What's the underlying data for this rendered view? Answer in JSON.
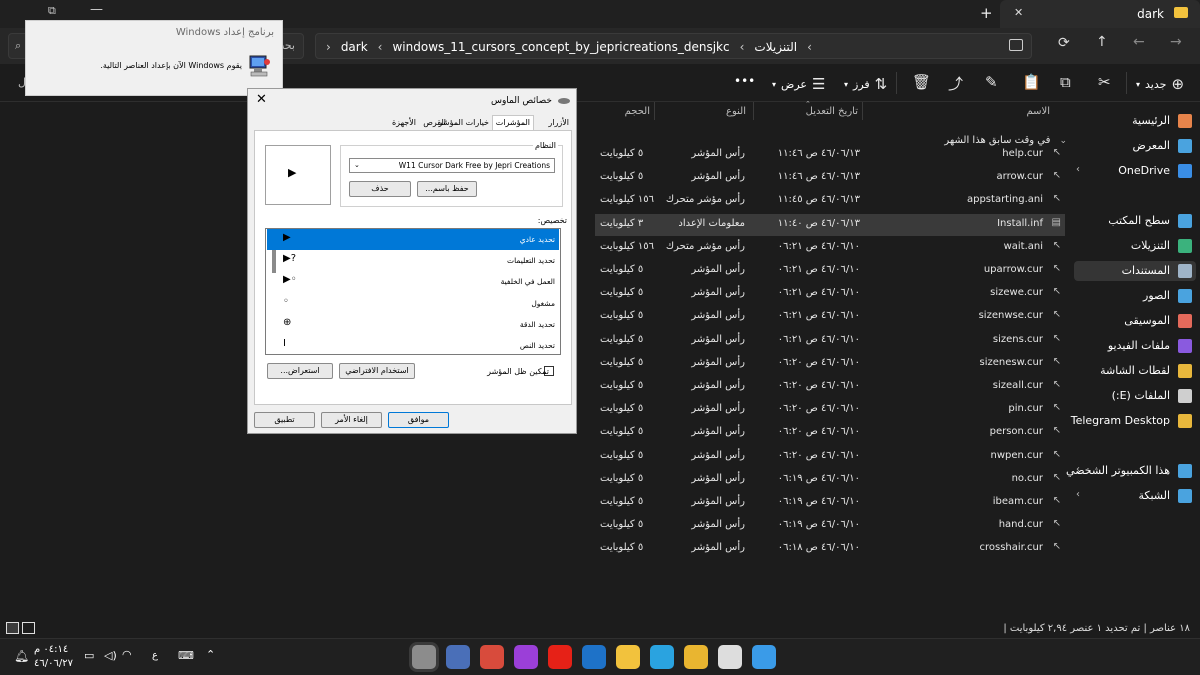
{
  "explorer": {
    "tab_title": "dark",
    "new_tab": "+",
    "tab_close": "✕",
    "window_controls": [
      "✕",
      "—"
    ],
    "breadcrumb": [
      "dark",
      "windows_11_cursors_concept_by_jepricreations_densjkc",
      "التنزيلات"
    ],
    "search_placeholder": "بحث",
    "toolbar": {
      "new_label": "جديد",
      "sort_label": "فرز",
      "view_label": "عرض",
      "more_label": "•••"
    },
    "sidebar": [
      {
        "label": "الرئيسية",
        "color": "#e7844b"
      },
      {
        "label": "المعرض",
        "color": "#4aa3df"
      },
      {
        "label": "OneDrive",
        "color": "#3a8ee6",
        "chev": true
      },
      {
        "label": "سطح المكتب",
        "color": "#4aa3df"
      },
      {
        "label": "التنزيلات",
        "color": "#3bb27d"
      },
      {
        "label": "المستندات",
        "color": "#9fb4c8",
        "selected": true
      },
      {
        "label": "الصور",
        "color": "#4aa3df"
      },
      {
        "label": "الموسيقى",
        "color": "#e46a5b"
      },
      {
        "label": "ملفات الفيديو",
        "color": "#8a5adf"
      },
      {
        "label": "لقطات الشاشة",
        "color": "#e8b73c"
      },
      {
        "label": "الملفات (E:)",
        "color": "#cfcfcf"
      },
      {
        "label": "Telegram Desktop",
        "color": "#e8b73c"
      },
      {
        "label": "هذا الكمبيوتر الشخصي",
        "color": "#4aa3df",
        "chev": true
      },
      {
        "label": "الشبكة",
        "color": "#4aa3df",
        "chev": true
      }
    ],
    "columns": {
      "name": "الاسم",
      "modified": "تاريخ التعديل",
      "type": "النوع",
      "size": "الحجم"
    },
    "group_header": "في وقت سابق هذا الشهر",
    "files": [
      {
        "name": "help.cur",
        "date": "٤٦/٠٦/١٣ ص ١١:٤٦",
        "type": "رأس المؤشر",
        "size": "٥ كيلوبايت"
      },
      {
        "name": "arrow.cur",
        "date": "٤٦/٠٦/١٣ ص ١١:٤٦",
        "type": "رأس المؤشر",
        "size": "٥ كيلوبايت"
      },
      {
        "name": "appstarting.ani",
        "date": "٤٦/٠٦/١٣ ص ١١:٤٥",
        "type": "رأس مؤشر متحرك",
        "size": "١٥٦ كيلوبايت"
      },
      {
        "name": "Install.inf",
        "date": "٤٦/٠٦/١٣ ص ١١:٤٠",
        "type": "معلومات الإعداد",
        "size": "٣ كيلوبايت",
        "selected": true
      },
      {
        "name": "wait.ani",
        "date": "٤٦/٠٦/١٠ ص ٠٦:٢١",
        "type": "رأس مؤشر متحرك",
        "size": "١٥٦ كيلوبايت"
      },
      {
        "name": "uparrow.cur",
        "date": "٤٦/٠٦/١٠ ص ٠٦:٢١",
        "type": "رأس المؤشر",
        "size": "٥ كيلوبايت"
      },
      {
        "name": "sizewe.cur",
        "date": "٤٦/٠٦/١٠ ص ٠٦:٢١",
        "type": "رأس المؤشر",
        "size": "٥ كيلوبايت"
      },
      {
        "name": "sizenwse.cur",
        "date": "٤٦/٠٦/١٠ ص ٠٦:٢١",
        "type": "رأس المؤشر",
        "size": "٥ كيلوبايت"
      },
      {
        "name": "sizens.cur",
        "date": "٤٦/٠٦/١٠ ص ٠٦:٢١",
        "type": "رأس المؤشر",
        "size": "٥ كيلوبايت"
      },
      {
        "name": "sizenesw.cur",
        "date": "٤٦/٠٦/١٠ ص ٠٦:٢٠",
        "type": "رأس المؤشر",
        "size": "٥ كيلوبايت"
      },
      {
        "name": "sizeall.cur",
        "date": "٤٦/٠٦/١٠ ص ٠٦:٢٠",
        "type": "رأس المؤشر",
        "size": "٥ كيلوبايت"
      },
      {
        "name": "pin.cur",
        "date": "٤٦/٠٦/١٠ ص ٠٦:٢٠",
        "type": "رأس المؤشر",
        "size": "٥ كيلوبايت"
      },
      {
        "name": "person.cur",
        "date": "٤٦/٠٦/١٠ ص ٠٦:٢٠",
        "type": "رأس المؤشر",
        "size": "٥ كيلوبايت"
      },
      {
        "name": "nwpen.cur",
        "date": "٤٦/٠٦/١٠ ص ٠٦:٢٠",
        "type": "رأس المؤشر",
        "size": "٥ كيلوبايت"
      },
      {
        "name": "no.cur",
        "date": "٤٦/٠٦/١٠ ص ٠٦:١٩",
        "type": "رأس المؤشر",
        "size": "٥ كيلوبايت"
      },
      {
        "name": "ibeam.cur",
        "date": "٤٦/٠٦/١٠ ص ٠٦:١٩",
        "type": "رأس المؤشر",
        "size": "٥ كيلوبايت"
      },
      {
        "name": "hand.cur",
        "date": "٤٦/٠٦/١٠ ص ٠٦:١٩",
        "type": "رأس المؤشر",
        "size": "٥ كيلوبايت"
      },
      {
        "name": "crosshair.cur",
        "date": "٤٦/٠٦/١٠ ص ٠٦:١٨",
        "type": "رأس المؤشر",
        "size": "٥ كيلوبايت"
      }
    ],
    "status": "١٨ عناصر | تم تحديد ١ عنصر ٢,٩٤ كيلوبايت |"
  },
  "setup_popup": {
    "title": "برنامج إعداد Windows",
    "message": "يقوم Windows الآن بإعداد العناصر التالية."
  },
  "mouse_dialog": {
    "title": "خصائص الماوس",
    "close": "✕",
    "tabs": [
      "الأزرار",
      "المؤشرات",
      "خيارات المؤشر",
      "القرص",
      "الأجهزة"
    ],
    "scheme_label": "النظام",
    "scheme_value": "W11 Cursor Dark Free by Jepri Creations",
    "save_as": "حفظ باسم...",
    "delete": "حذف",
    "customize_label": "تخصيص:",
    "cursor_rows": [
      {
        "label": "تحديد عادي",
        "glyph": "▶",
        "selected": true
      },
      {
        "label": "تحديد التعليمات",
        "glyph": "▶?"
      },
      {
        "label": "العمل في الخلفية",
        "glyph": "▶◦"
      },
      {
        "label": "مشغول",
        "glyph": "◦"
      },
      {
        "label": "تحديد الدقة",
        "glyph": "⊕"
      },
      {
        "label": "تحديد النص",
        "glyph": "I"
      }
    ],
    "shadow_label": "تمكين ظل المؤشر",
    "use_default": "استخدام الافتراضي",
    "browse": "استعراض...",
    "ok": "موافق",
    "cancel": "إلغاء الأمر",
    "apply": "تطبيق"
  },
  "taskbar": {
    "time": "٠٤:١٤ م",
    "date": "٤٦/٠٦/٢٧",
    "lang": "ع",
    "apps": [
      {
        "name": "mouse-app",
        "color": "#8c8c8c"
      },
      {
        "name": "setup-app",
        "color": "#4a6fb8"
      },
      {
        "name": "store-app",
        "color": "#d84b3c"
      },
      {
        "name": "heart-app",
        "color": "#9b3fd8"
      },
      {
        "name": "youtube-app",
        "color": "#e62117"
      },
      {
        "name": "outlook-app",
        "color": "#1e72c8"
      },
      {
        "name": "explorer-app",
        "color": "#f2c23d"
      },
      {
        "name": "telegram-app",
        "color": "#2aa3e0"
      },
      {
        "name": "chrome-app",
        "color": "#e9b530"
      },
      {
        "name": "search-app",
        "color": "#dddddd"
      },
      {
        "name": "start-app",
        "color": "#3a9be8"
      }
    ]
  }
}
